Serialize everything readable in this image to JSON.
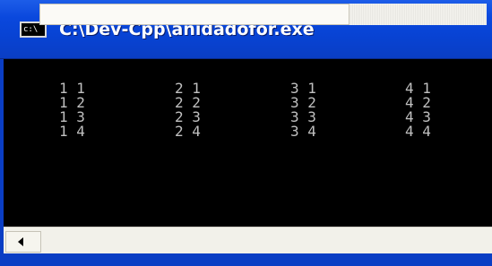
{
  "window": {
    "title": "C:\\Dev-Cpp\\anidadofor.exe",
    "app_icon_label": "c:\\"
  },
  "console": {
    "rows": [
      [
        "1 1",
        "2 1",
        "3 1",
        "4 1"
      ],
      [
        "1 2",
        "2 2",
        "3 2",
        "4 2"
      ],
      [
        "1 3",
        "2 3",
        "3 3",
        "4 3"
      ],
      [
        "1 4",
        "2 4",
        "3 4",
        "4 4"
      ]
    ],
    "text_color": "#c0c0c0",
    "background_color": "#000000"
  },
  "scrollbar": {
    "left_arrow_icon": "arrow-left-icon"
  },
  "colors": {
    "titlebar": "#0a48dd",
    "title_text": "#ffffff"
  }
}
